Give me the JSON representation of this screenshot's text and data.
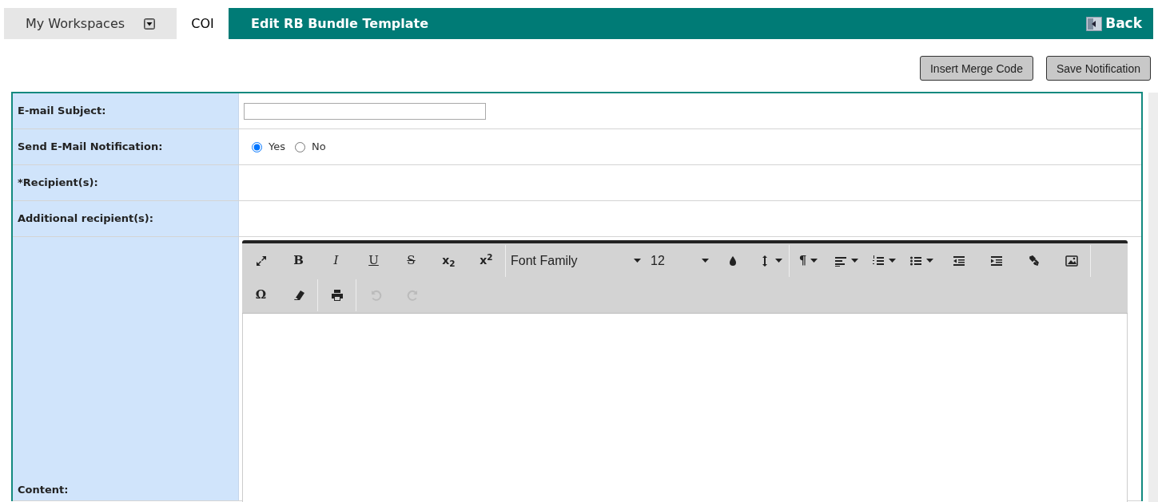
{
  "nav": {
    "workspaces_label": "My Workspaces",
    "tab_label": "COI",
    "title": "Edit RB Bundle Template",
    "back_label": "Back"
  },
  "actions": [
    "Insert Merge Code",
    "Save Notification"
  ],
  "form": {
    "rows": [
      {
        "kind": "text",
        "label": "E-mail Subject:"
      },
      {
        "kind": "radio",
        "label": "Send E-Mail Notification:",
        "options": [
          {
            "label": "Yes",
            "selected": true
          },
          {
            "label": "No",
            "selected": false
          }
        ]
      },
      {
        "kind": "empty",
        "label": "*Recipient(s):"
      },
      {
        "kind": "empty",
        "label": "Additional recipient(s):"
      },
      {
        "kind": "editor",
        "label": "Content:"
      }
    ]
  },
  "toolbar": {
    "rows": [
      [
        {
          "kind": "expand",
          "disabled": false
        },
        {
          "kind": "bold",
          "text": "B",
          "disabled": false
        },
        {
          "kind": "italic",
          "text": "I",
          "disabled": false
        },
        {
          "kind": "underline",
          "text": "U",
          "disabled": false
        },
        {
          "kind": "strike",
          "text": "S",
          "disabled": false
        },
        {
          "kind": "script",
          "text": "x$_{2}$",
          "disabled": false
        },
        {
          "kind": "script",
          "text": "x$^{2}$",
          "disabled": false
        },
        {
          "kind": "separator"
        },
        {
          "kind": "select",
          "text": "Font Family"
        },
        {
          "kind": "select",
          "text": "12"
        },
        {
          "kind": "color",
          "disabled": false
        },
        {
          "kind": "lineheight",
          "disabled": false
        },
        {
          "kind": "separator"
        },
        {
          "kind": "paragraph",
          "text": "¶",
          "disabled": false
        },
        {
          "kind": "align",
          "disabled": false
        },
        {
          "kind": "ordered",
          "disabled": false
        },
        {
          "kind": "bullets",
          "disabled": false
        },
        {
          "kind": "outdent",
          "disabled": false
        },
        {
          "kind": "indent",
          "disabled": false
        },
        {
          "kind": "link",
          "disabled": false
        },
        {
          "kind": "image",
          "disabled": false
        },
        {
          "kind": "separator"
        }
      ],
      [
        {
          "kind": "symbol",
          "text": "Ω",
          "disabled": false
        },
        {
          "kind": "eraser",
          "disabled": false
        },
        {
          "kind": "separator"
        },
        {
          "kind": "print",
          "disabled": false
        },
        {
          "kind": "separator"
        },
        {
          "kind": "undo",
          "disabled": true
        },
        {
          "kind": "redo",
          "disabled": true
        }
      ]
    ]
  }
}
